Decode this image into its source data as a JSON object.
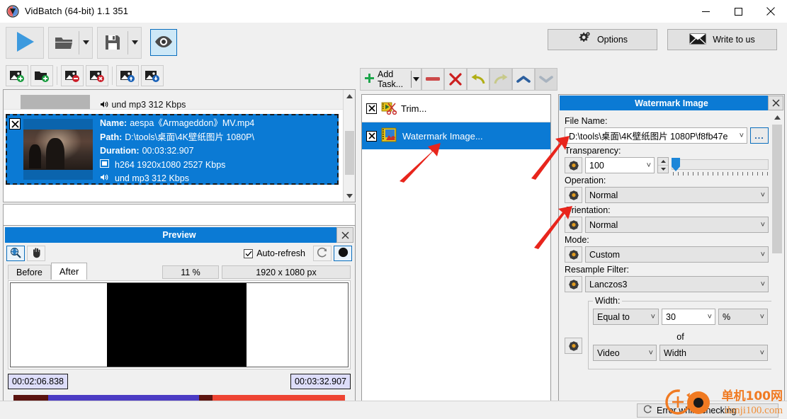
{
  "window": {
    "title": "VidBatch (64-bit) 1.1 351",
    "icon": "app-logo-icon",
    "minimize": "minimize-icon",
    "maximize": "maximize-icon",
    "close": "close-icon"
  },
  "toolbar": {
    "run_icon": "play-icon",
    "open_icon": "folder-open-icon",
    "save_icon": "save-icon",
    "preview_icon": "eye-icon",
    "options_label": "Options",
    "options_icon": "gear-icon",
    "write_label": "Write to us",
    "write_icon": "envelope-icon"
  },
  "file_toolbar": {
    "buttons": [
      {
        "name": "add-files-button",
        "icon": "image-plus-icon"
      },
      {
        "name": "add-folder-button",
        "icon": "folder-plus-icon"
      },
      {
        "name": "remove-file-button",
        "icon": "image-minus-icon"
      },
      {
        "name": "remove-all-button",
        "icon": "image-delete-icon"
      },
      {
        "name": "move-up-button",
        "icon": "image-up-icon"
      },
      {
        "name": "move-down-button",
        "icon": "image-down-icon"
      }
    ]
  },
  "file_list": {
    "partial_item": {
      "audio": "und mp3 312 Kbps"
    },
    "selected_item": {
      "name_label": "Name:",
      "name_value": "aespa《Armageddon》MV.mp4",
      "path_label": "Path:",
      "path_value": "D:\\tools\\桌面\\4K壁纸图片 1080P\\",
      "duration_label": "Duration:",
      "duration_value": "00:03:32.907",
      "video_icon": "film-icon",
      "video_value": "h264 1920x1080 2527 Kbps",
      "audio_icon": "speaker-icon",
      "audio_value": "und mp3 312 Kbps",
      "remove_icon": "x-box-icon"
    }
  },
  "preview": {
    "title": "Preview",
    "close_icon": "close-icon",
    "zoom_tool_icon": "zoom-fit-icon",
    "pan_tool_icon": "hand-icon",
    "autorefresh_label": "Auto-refresh",
    "autorefresh_checked": true,
    "refresh_icon": "refresh-icon",
    "record_icon": "circle-filled-icon",
    "tabs": [
      {
        "label": "Before",
        "active": false
      },
      {
        "label": "After",
        "active": true
      }
    ],
    "zoom_percent": "11 %",
    "dimensions": "1920 x 1080 px",
    "time_start": "00:02:06.838",
    "time_end": "00:03:32.907"
  },
  "tasks": {
    "toolbar": {
      "add_task_label": "Add Task...",
      "add_task_icon": "plus-icon",
      "add_task_dropdown_icon": "chevron-down-icon",
      "remove_icon": "minus-icon",
      "delete_icon": "x-icon",
      "undo_icon": "undo-arrow-icon",
      "redo_icon": "redo-arrow-icon",
      "move_up_icon": "chevron-up-icon",
      "move_down_icon": "chevron-down-icon"
    },
    "items": [
      {
        "label": "Trim...",
        "icon": "trim-task-icon",
        "selected": false,
        "checkbox_icon": "x-box-icon"
      },
      {
        "label": "Watermark Image...",
        "icon": "watermark-task-icon",
        "selected": true,
        "checkbox_icon": "x-box-icon"
      }
    ]
  },
  "panel": {
    "title": "Watermark Image",
    "close_icon": "close-icon",
    "file_name_label": "File Name:",
    "file_name_value": "D:\\tools\\桌面\\4K壁纸图片 1080P\\f8fb47e",
    "browse_label": "...",
    "transparency_label": "Transparency:",
    "transparency_value": "100",
    "operation_label": "Operation:",
    "operation_value": "Normal",
    "orientation_label": "Orientation:",
    "orientation_value": "Normal",
    "mode_label": "Mode:",
    "mode_value": "Custom",
    "resample_label": "Resample Filter:",
    "resample_value": "Lanczos3",
    "width_group_label": "Width:",
    "width_comparator": "Equal to",
    "width_value": "30",
    "width_unit": "%",
    "of_label": "of",
    "of_source": "Video",
    "of_dimension": "Width",
    "key_icon": "keyframe-icon"
  },
  "status": {
    "icon": "refresh-icon",
    "text": "Error while checking"
  },
  "watermark": {
    "line1": "单机100网",
    "line2": "danji100.com",
    "color": "#f07a22"
  },
  "colors": {
    "accent": "#0b7ad4",
    "window_bg": "#f0f0f0",
    "annotation_arrow": "#e8251c"
  }
}
